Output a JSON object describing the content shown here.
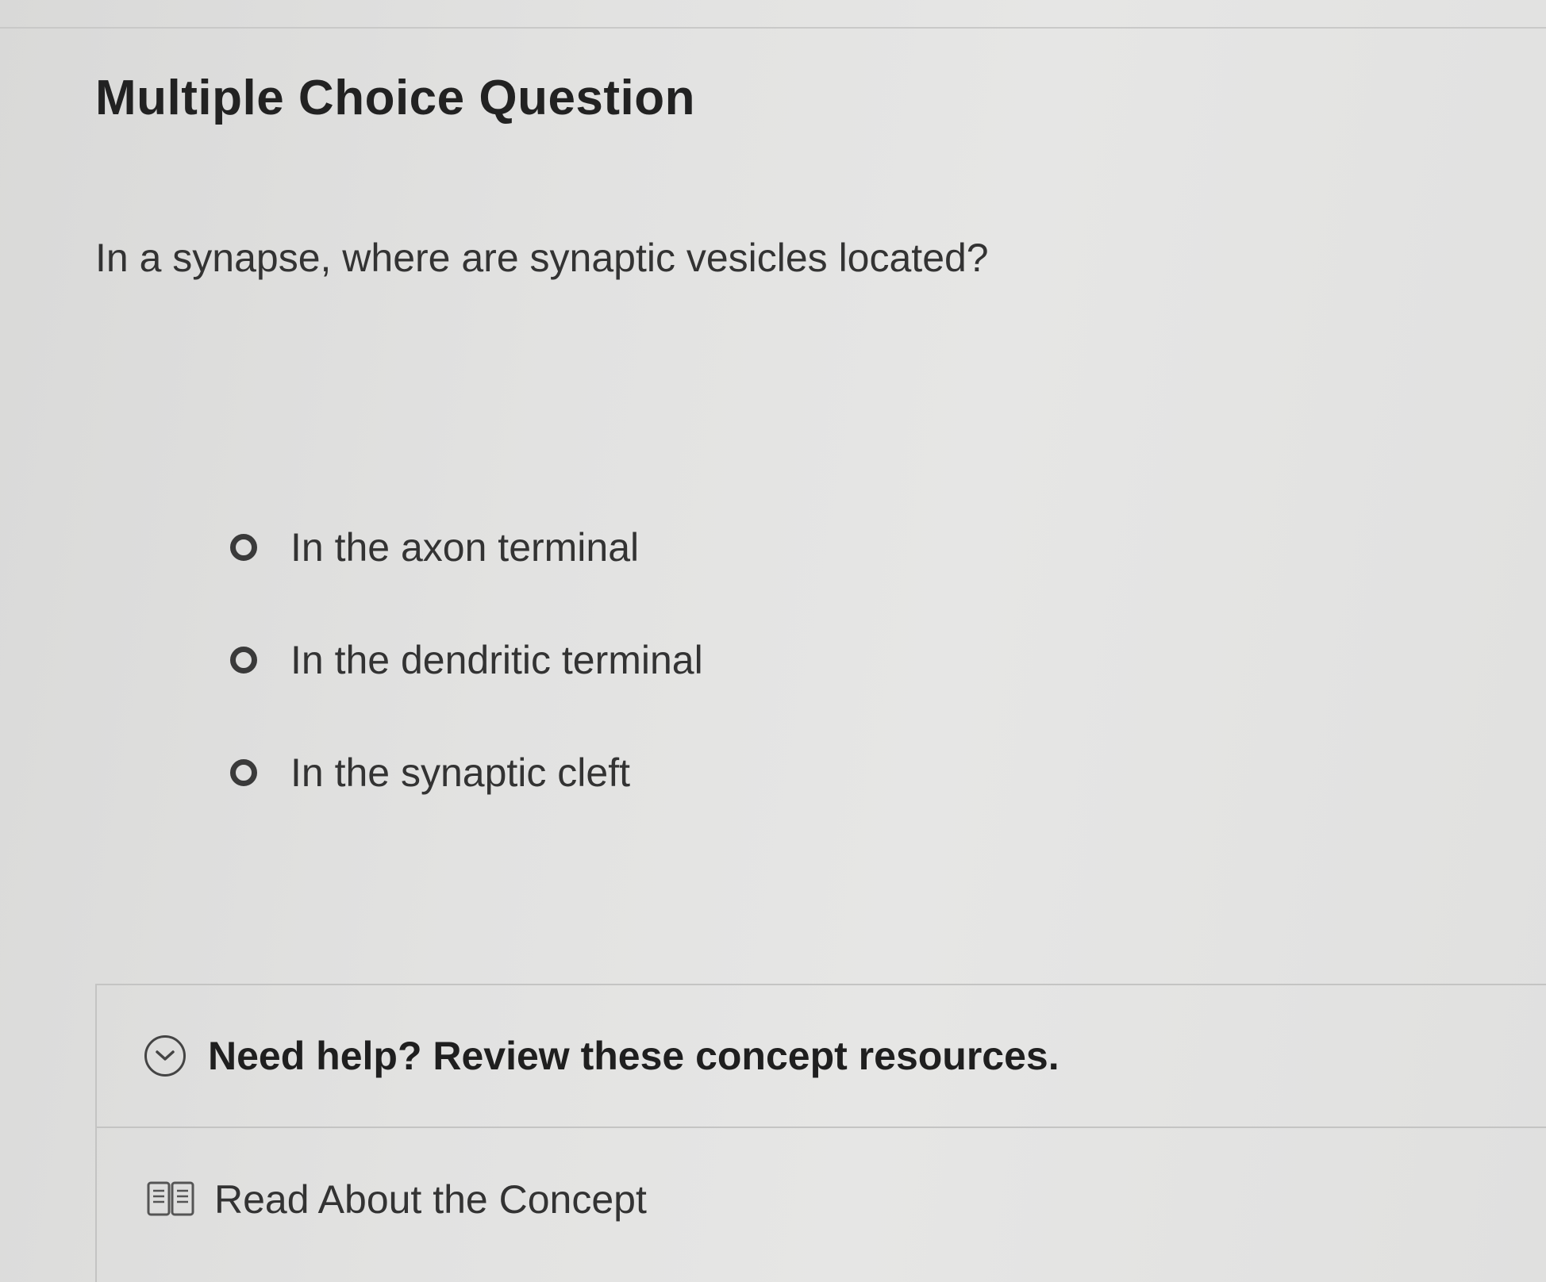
{
  "question": {
    "type_title": "Multiple Choice Question",
    "prompt": "In a synapse, where are synaptic vesicles located?",
    "choices": [
      {
        "label": "In the axon terminal",
        "selected": false
      },
      {
        "label": "In the dendritic terminal",
        "selected": false
      },
      {
        "label": "In the synaptic cleft",
        "selected": false
      }
    ]
  },
  "help": {
    "title": "Need help? Review these concept resources.",
    "toggle_icon": "chevron-down-circle-icon",
    "resources": [
      {
        "label": "Read About the Concept",
        "icon": "book-icon"
      }
    ]
  },
  "colors": {
    "text": "#333333",
    "radio_border": "#3a3a3a",
    "divider": "#c4c4c3"
  }
}
